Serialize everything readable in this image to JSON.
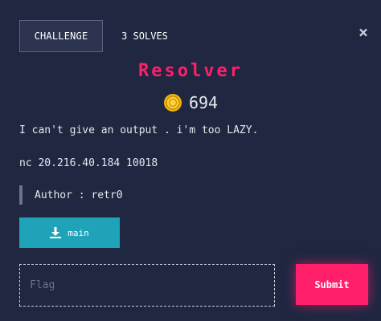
{
  "tabs": {
    "challenge_label": "CHALLENGE",
    "solves_label": "3 SOLVES"
  },
  "close_symbol": "×",
  "challenge": {
    "name": "Resolver",
    "points": "694",
    "description": "I can't give an output . i'm too LAZY.",
    "connection": "nc 20.216.40.184 10018",
    "author": "Author : retr0"
  },
  "download": {
    "label": "main",
    "icon": "download-icon"
  },
  "flag_form": {
    "placeholder": "Flag",
    "value": "",
    "submit_label": "Submit"
  },
  "colors": {
    "background": "#1f2741",
    "accent": "#ff1f6b",
    "download_button": "#1fa3b8",
    "coin": "#f2b705"
  }
}
